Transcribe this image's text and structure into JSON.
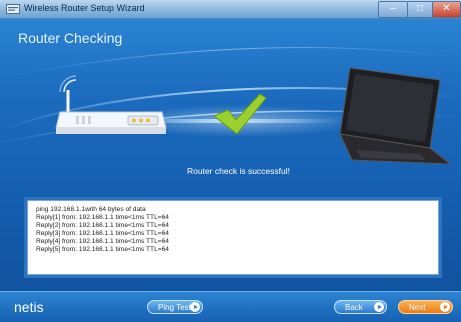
{
  "window": {
    "title": "Wireless Router Setup Wizard",
    "controls": [
      "minimize",
      "maximize",
      "close"
    ]
  },
  "page": {
    "heading": "Router Checking",
    "status_message": "Router check is successful!"
  },
  "log": {
    "lines": [
      "ping 192.168.1.1with 64 bytes of data",
      "Reply[1] from: 192.168.1.1 time<1ms TTL=64",
      "Reply[2] from: 192.168.1.1 time<1ms TTL=64",
      "Reply[3] from: 192.168.1.1 time<1ms TTL=64",
      "Reply[4] from: 192.168.1.1 time<1ms TTL=64",
      "Reply[5] from: 192.168.1.1 time<1ms TTL=64"
    ]
  },
  "footer": {
    "brand": "netis",
    "ping_test_label": "Ping Test",
    "back_label": "Back",
    "next_label": "Next"
  },
  "colors": {
    "background": "#1c6cc0",
    "accent_green": "#9bd12e",
    "next_orange": "#ec7a14"
  },
  "icons": [
    "window-app-icon",
    "router-icon",
    "checkmark-icon",
    "laptop-icon",
    "arrow-right-icon"
  ]
}
